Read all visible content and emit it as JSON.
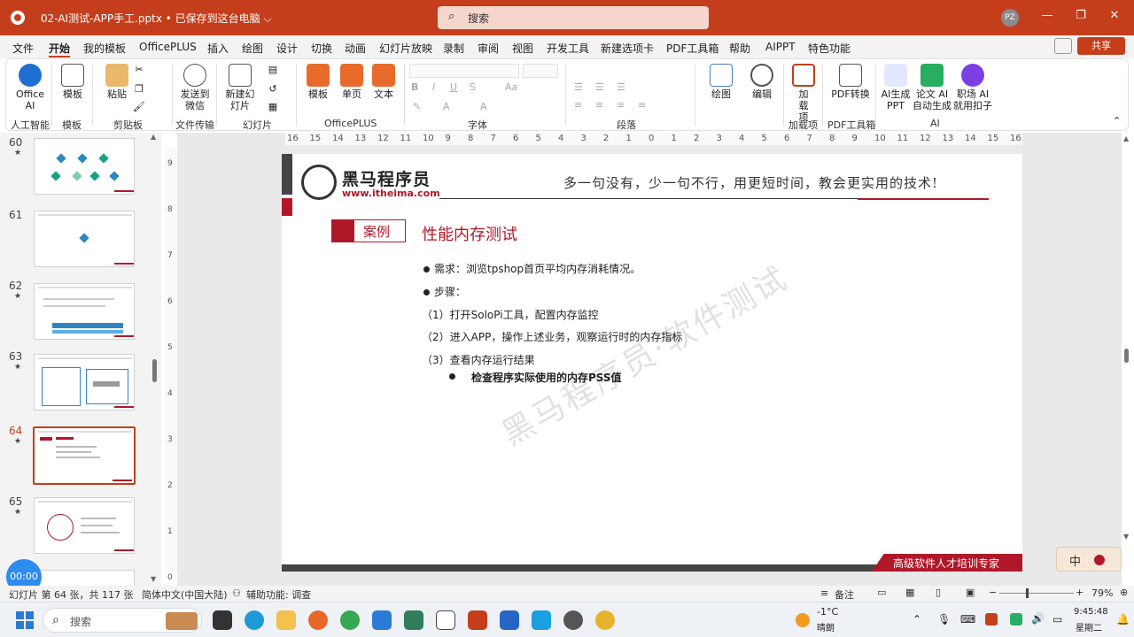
{
  "title_bar": {
    "file_name": "02-AI测试-APP手工.pptx • 已保存到这台电脑 ⌵",
    "search_placeholder": "搜索",
    "user_initials": "PZ"
  },
  "menu": [
    "文件",
    "开始",
    "我的模板",
    "OfficePLUS",
    "插入",
    "绘图",
    "设计",
    "切换",
    "动画",
    "幻灯片放映",
    "录制",
    "审阅",
    "视图",
    "开发工具",
    "新建选项卡",
    "PDF工具箱",
    "帮助",
    "AIPPT",
    "特色功能"
  ],
  "share_label": "共享",
  "ribbon": {
    "buttons": {
      "office_ai": "Office AI",
      "template": "模板",
      "paste": "粘贴",
      "send_wechat": "发送到微信",
      "new_slide": "新建幻灯片",
      "op_template": "模板",
      "single_page": "单页",
      "text": "文本",
      "draw": "绘图",
      "edit": "编辑",
      "addin": "加载项",
      "pdf_convert": "PDF转换",
      "ai_ppt": "AI生成PPT",
      "paper_ai": "论文 AI 自动生成",
      "job_ai": "职场 AI 就用扣子"
    },
    "groups": {
      "ai_tools": "人工智能",
      "template": "模板",
      "clipboard": "剪贴板",
      "file_transfer": "文件传输",
      "slides": "幻灯片",
      "officeplus": "OfficePLUS",
      "font": "字体",
      "paragraph": "段落",
      "addins": "加载项",
      "pdf_tools": "PDF工具箱",
      "ai": "AI"
    }
  },
  "thumbnails": [
    {
      "num": "60",
      "star": "★"
    },
    {
      "num": "61",
      "star": ""
    },
    {
      "num": "62",
      "star": "★"
    },
    {
      "num": "63",
      "star": "★"
    },
    {
      "num": "64",
      "star": "★"
    },
    {
      "num": "65",
      "star": "★"
    }
  ],
  "ruler_ticks": [
    "16",
    "15",
    "14",
    "13",
    "12",
    "11",
    "10",
    "9",
    "8",
    "7",
    "6",
    "5",
    "4",
    "3",
    "2",
    "1",
    "0",
    "1",
    "2",
    "3",
    "4",
    "5",
    "6",
    "7",
    "8",
    "9",
    "10",
    "11",
    "12",
    "13",
    "14",
    "15",
    "16"
  ],
  "slide": {
    "logo_name": "黑马程序员",
    "logo_url": "www.itheima.com",
    "slogan": "多一句没有，少一句不行，用更短时间，教会更实用的技术!",
    "tag": "案例",
    "title": "性能内存测试",
    "bullets": [
      "需求：浏览tpshop首页平均内存消耗情况。",
      "步骤："
    ],
    "steps": [
      "（1）打开SoloPi工具，配置内存监控",
      "（2）进入APP，操作上述业务，观察运行时的内存指标",
      "（3）查看内存运行结果"
    ],
    "sub_bullet": "检查程序实际使用的内存PSS值",
    "watermark": "黑马程序员·软件测试",
    "footer_label": "高级软件人才培训专家"
  },
  "status": {
    "slide_info": "幻灯片 第 64 张，共 117 张",
    "language": "简体中文(中国大陆)",
    "accessibility": "辅助功能: 调查",
    "notes": "备注",
    "zoom": "79%"
  },
  "timer": "00:00",
  "ime": "中",
  "taskbar": {
    "search": "搜索",
    "weather_temp": "-1°C",
    "weather_desc": "晴朗",
    "time": "9:45:48",
    "day": "星期二"
  },
  "colors": {
    "accent": "#c43e1c",
    "brand_red": "#b0182a"
  }
}
